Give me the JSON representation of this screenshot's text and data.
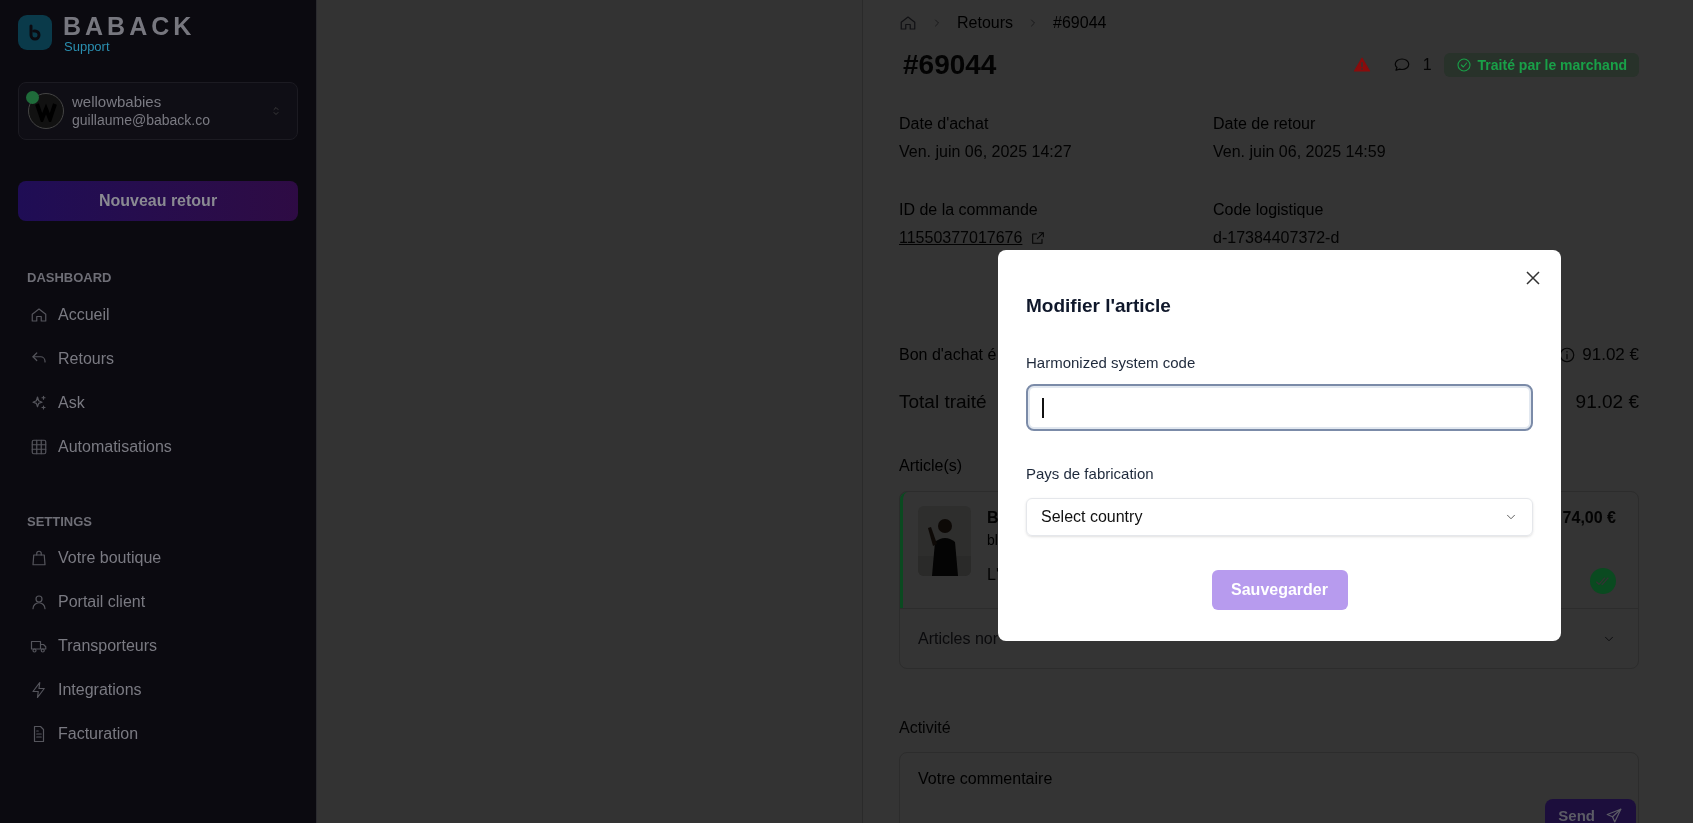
{
  "sidebar": {
    "brand": {
      "name": "BABACK",
      "subtitle": "Support"
    },
    "account": {
      "name": "wellowbabies",
      "email": "guillaume@baback.co",
      "online": true
    },
    "new_button": "Nouveau retour",
    "sections": [
      {
        "title": "DASHBOARD",
        "items": [
          {
            "label": "Accueil"
          },
          {
            "label": "Retours"
          },
          {
            "label": "Ask"
          },
          {
            "label": "Automatisations"
          }
        ]
      },
      {
        "title": "SETTINGS",
        "items": [
          {
            "label": "Votre boutique"
          },
          {
            "label": "Portail client"
          },
          {
            "label": "Transporteurs"
          },
          {
            "label": "Integrations"
          },
          {
            "label": "Facturation"
          }
        ]
      }
    ]
  },
  "main": {
    "breadcrumb": [
      "Retours",
      "#69044"
    ],
    "title": "#69044",
    "warning": true,
    "comment_count": "1",
    "status": "Traité par le marchand",
    "details": [
      {
        "label": "Date d'achat",
        "value": "Ven. juin 06, 2025 14:27",
        "kind": "text"
      },
      {
        "label": "Date de retour",
        "value": "Ven. juin 06, 2025 14:59",
        "kind": "text"
      },
      {
        "label": "ID de la commande",
        "value": "11550377017676",
        "kind": "link"
      },
      {
        "label": "Code logistique",
        "value": "d-17384407372-d",
        "kind": "text"
      }
    ],
    "summary": [
      {
        "label": "Bon d'achat é",
        "value": "91.02 €",
        "info": true,
        "kind": "sub"
      },
      {
        "label": "Total traité",
        "value": "91.02 €",
        "info": false,
        "kind": "total"
      }
    ],
    "articles_heading": "Article(s)",
    "article": {
      "name": "B",
      "subtitle": "bl",
      "note": "L'",
      "price": "74,00 €",
      "validated": true
    },
    "non_returned": "Articles nor",
    "activity_heading": "Activité",
    "comment_placeholder": "Votre commentaire",
    "send_button": "Send"
  },
  "modal": {
    "title": "Modifier l'article",
    "fields": [
      {
        "label": "Harmonized system code",
        "kind": "text",
        "focused": true
      },
      {
        "label": "Pays de fabrication",
        "kind": "select",
        "value": "Select country",
        "focused": false
      }
    ],
    "save_button": {
      "label": "Sauvegarder",
      "disabled": true
    }
  }
}
